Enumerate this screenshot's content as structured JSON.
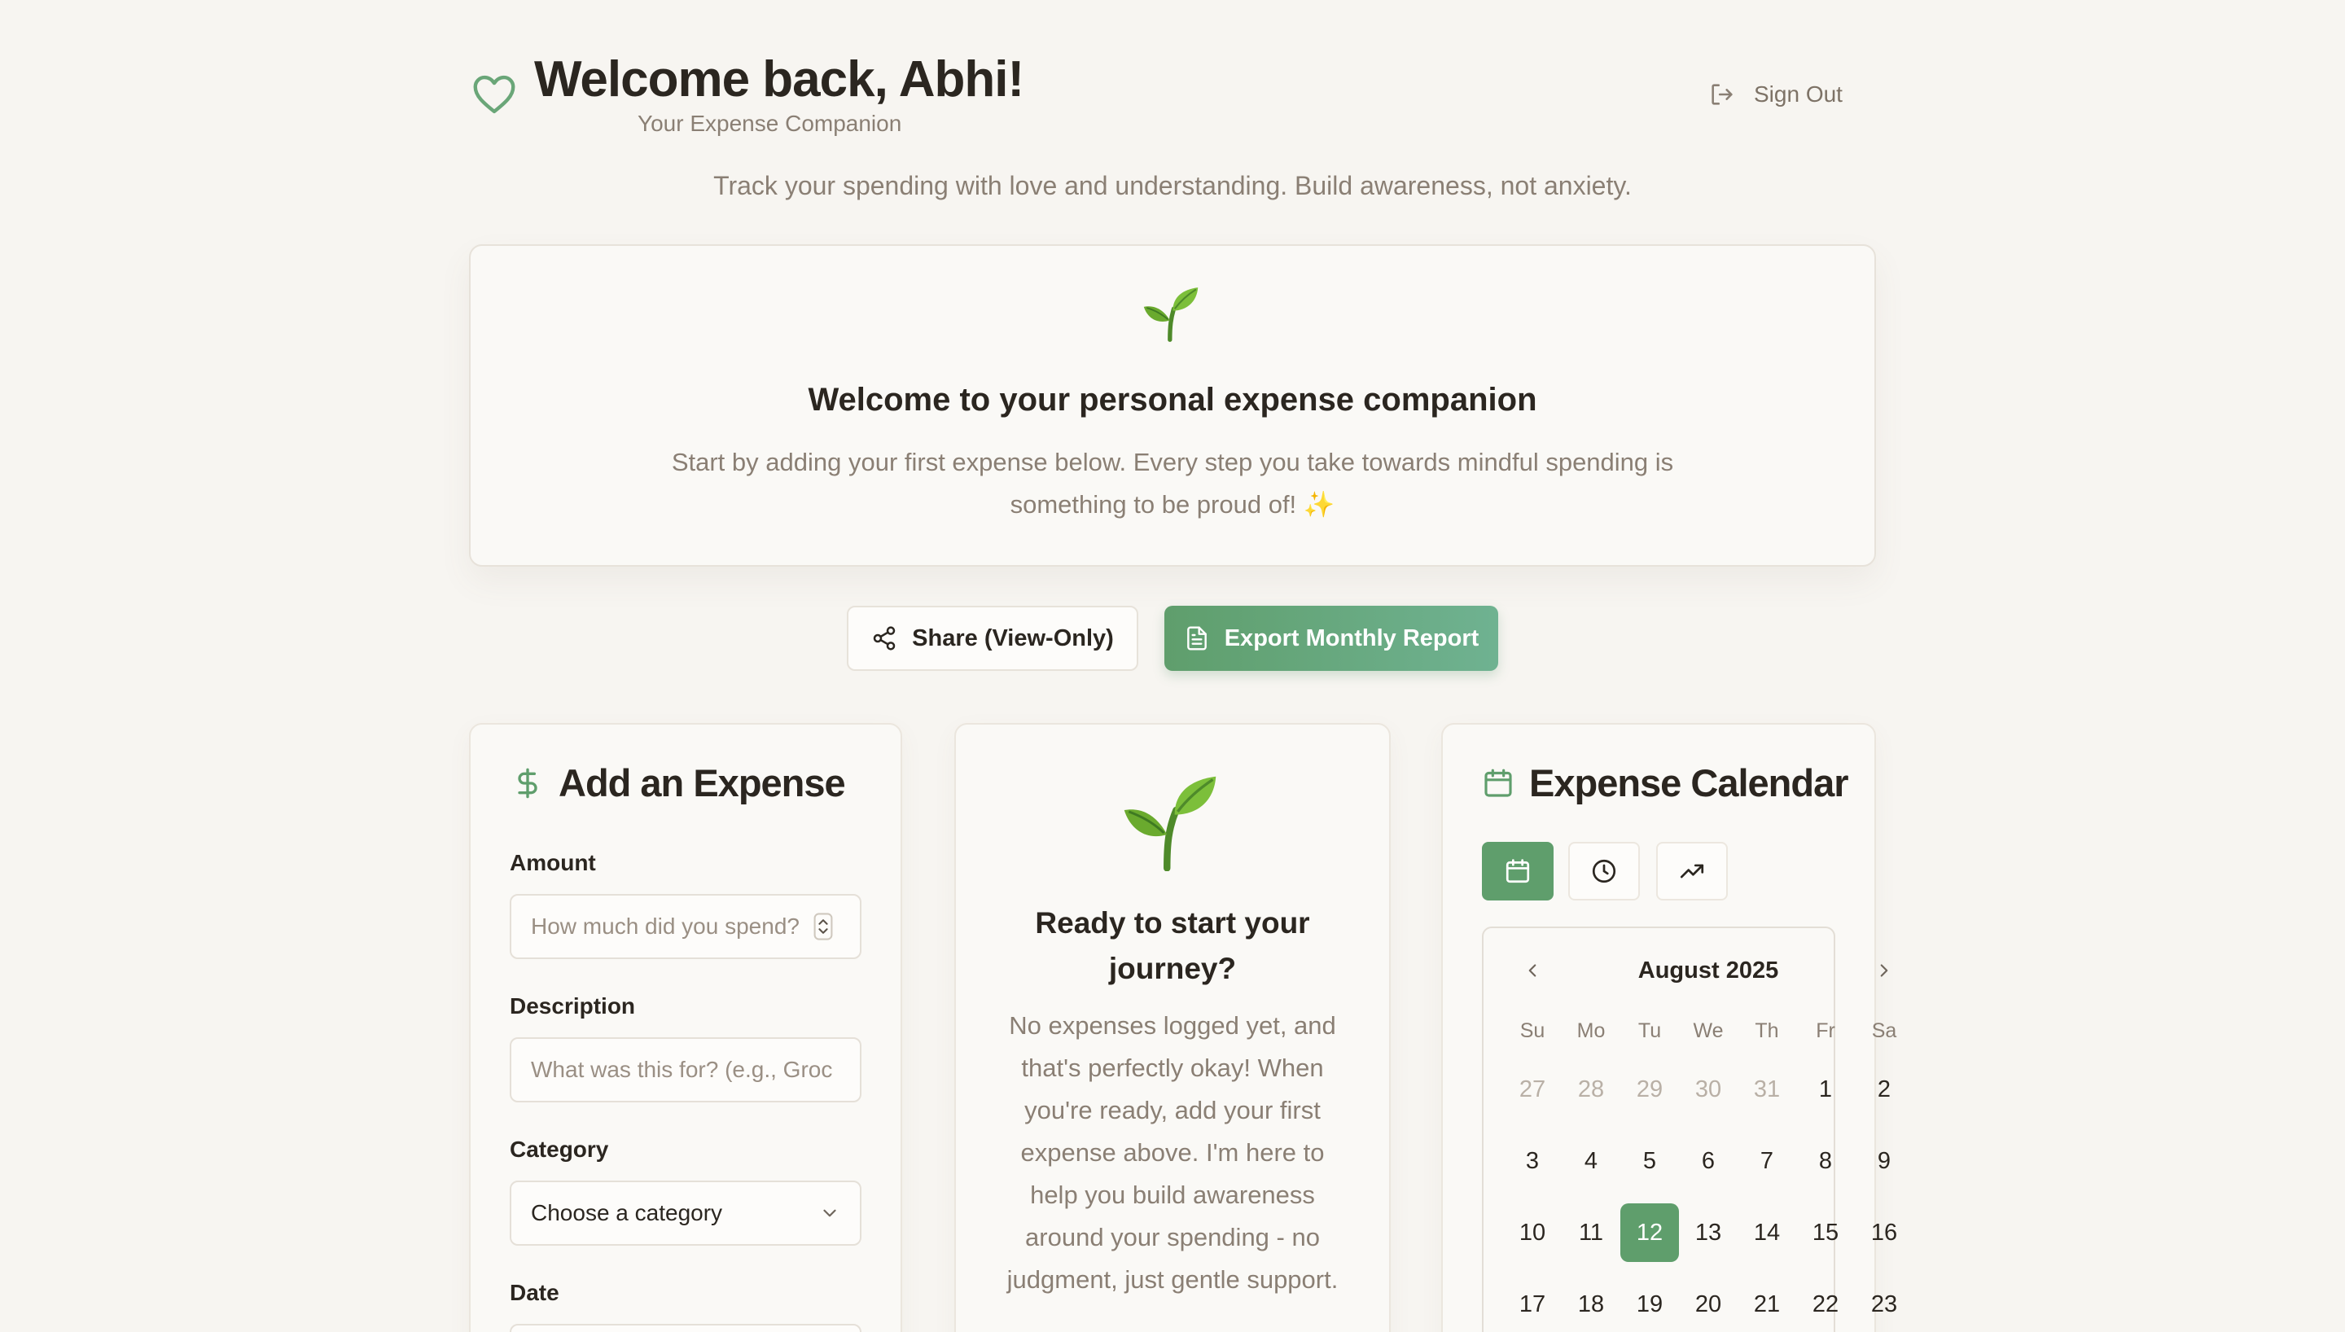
{
  "header": {
    "title": "Welcome back, Abhi!",
    "subtitle": "Your Expense Companion",
    "sign_out": "Sign Out",
    "tagline": "Track your spending with love and understanding. Build awareness, not anxiety."
  },
  "welcome_card": {
    "title": "Welcome to your personal expense companion",
    "body": "Start by adding your first expense below. Every step you take towards mindful spending is something to be proud of! ✨"
  },
  "actions": {
    "share": "Share (View-Only)",
    "export": "Export Monthly Report"
  },
  "add_expense": {
    "title": "Add an Expense",
    "amount_label": "Amount",
    "amount_placeholder": "How much did you spend?",
    "description_label": "Description",
    "description_placeholder": "What was this for? (e.g., Groc",
    "category_label": "Category",
    "category_value": "Choose a category",
    "date_label": "Date"
  },
  "empty_state": {
    "title": "Ready to start your journey?",
    "body": "No expenses logged yet, and that's perfectly okay! When you're ready, add your first expense above. I'm here to help you build awareness around your spending - no judgment, just gentle support."
  },
  "calendar": {
    "title": "Expense Calendar",
    "month": "August 2025",
    "weekdays": [
      "Su",
      "Mo",
      "Tu",
      "We",
      "Th",
      "Fr",
      "Sa"
    ],
    "weeks": [
      [
        {
          "d": "27",
          "m": true
        },
        {
          "d": "28",
          "m": true
        },
        {
          "d": "29",
          "m": true
        },
        {
          "d": "30",
          "m": true
        },
        {
          "d": "31",
          "m": true
        },
        {
          "d": "1"
        },
        {
          "d": "2"
        }
      ],
      [
        {
          "d": "3"
        },
        {
          "d": "4"
        },
        {
          "d": "5"
        },
        {
          "d": "6"
        },
        {
          "d": "7"
        },
        {
          "d": "8"
        },
        {
          "d": "9"
        }
      ],
      [
        {
          "d": "10"
        },
        {
          "d": "11"
        },
        {
          "d": "12",
          "s": true
        },
        {
          "d": "13"
        },
        {
          "d": "14"
        },
        {
          "d": "15"
        },
        {
          "d": "16"
        }
      ],
      [
        {
          "d": "17"
        },
        {
          "d": "18"
        },
        {
          "d": "19"
        },
        {
          "d": "20"
        },
        {
          "d": "21"
        },
        {
          "d": "22"
        },
        {
          "d": "23"
        }
      ]
    ]
  },
  "colors": {
    "accent": "#5f9e6c",
    "background": "#f7f5f1",
    "muted_text": "#8a7f74"
  }
}
